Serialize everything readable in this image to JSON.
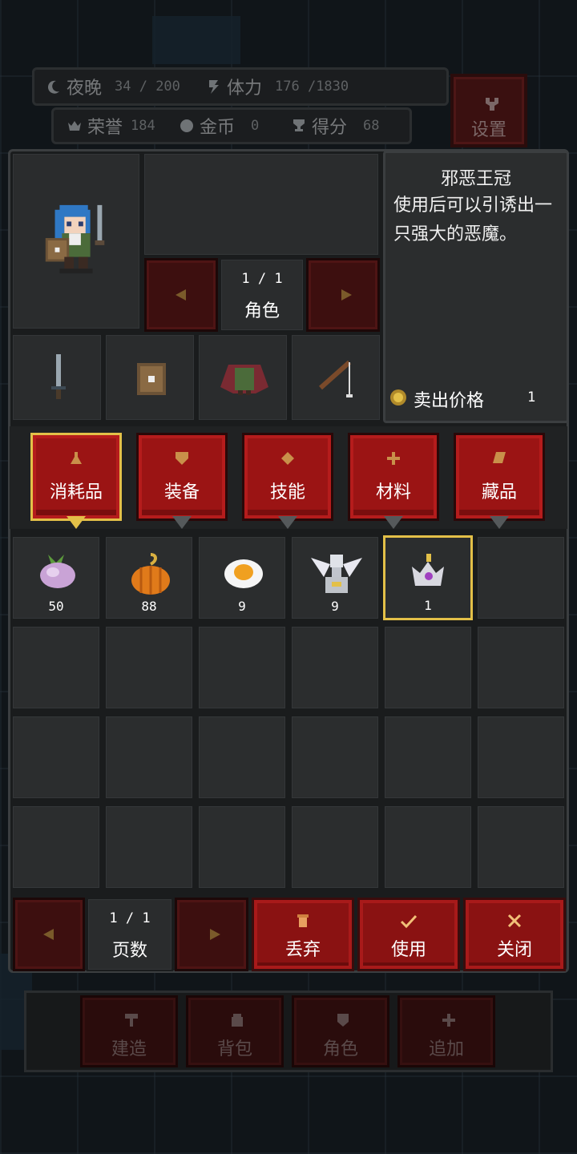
{
  "hud": {
    "night_label": "夜晚",
    "night_value": "34 / 200",
    "stamina_label": "体力",
    "stamina_value": "176 /1830",
    "honor_label": "荣誉",
    "honor_value": "184",
    "gold_label": "金币",
    "gold_value": "0",
    "score_label": "得分",
    "score_value": "68",
    "settings_label": "设置"
  },
  "character": {
    "page": "1 / 1",
    "page_label": "角色",
    "equipment_icons": [
      "sword-icon",
      "shield-icon",
      "cloak-icon",
      "fishing-rod-icon"
    ]
  },
  "item_detail": {
    "name": "邪恶王冠",
    "description": "使用后可以引诱出一只强大的恶魔。",
    "sell_label": "卖出价格",
    "sell_value": "1"
  },
  "tabs": [
    {
      "label": "消耗品",
      "icon": "flask-icon",
      "active": true
    },
    {
      "label": "装备",
      "icon": "shield-icon",
      "active": false
    },
    {
      "label": "技能",
      "icon": "diamond-icon",
      "active": false
    },
    {
      "label": "材料",
      "icon": "sparkle-icon",
      "active": false
    },
    {
      "label": "藏品",
      "icon": "leaf-icon",
      "active": false
    }
  ],
  "inventory": [
    {
      "icon": "turnip-icon",
      "qty": "50"
    },
    {
      "icon": "pumpkin-icon",
      "qty": "88"
    },
    {
      "icon": "fried-egg-icon",
      "qty": "9"
    },
    {
      "icon": "winged-statue-icon",
      "qty": "9"
    },
    {
      "icon": "crown-icon",
      "qty": "1",
      "selected": true
    }
  ],
  "pager": {
    "page": "1 / 1",
    "page_label": "页数"
  },
  "actions": {
    "discard_label": "丢弃",
    "use_label": "使用",
    "close_label": "关闭"
  },
  "bottom_nav": [
    {
      "label": "建造",
      "icon": "hammer-icon"
    },
    {
      "label": "背包",
      "icon": "bag-icon"
    },
    {
      "label": "角色",
      "icon": "character-icon"
    },
    {
      "label": "追加",
      "icon": "plus-icon"
    }
  ],
  "colors": {
    "accent_gold": "#e3c048",
    "button_red": "#9b1414",
    "panel_dark": "#1a1c1d"
  }
}
